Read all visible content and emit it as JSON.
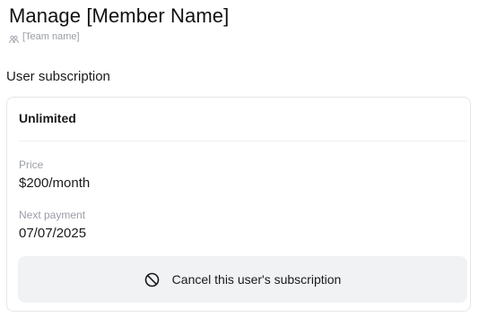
{
  "header": {
    "title": "Manage [Member Name]",
    "team_name": "[Team name]",
    "team_icon": "team-icon"
  },
  "subscription": {
    "section_title": "User subscription",
    "plan_name": "Unlimited",
    "price_label": "Price",
    "price_value": "$200/month",
    "next_payment_label": "Next payment",
    "next_payment_value": "07/07/2025",
    "cancel_button": {
      "label": "Cancel this user's subscription",
      "icon": "cancel-icon"
    }
  },
  "colors": {
    "muted_text": "#9a9ea6",
    "card_border": "#e4e6ea",
    "button_background": "#f1f2f4"
  }
}
